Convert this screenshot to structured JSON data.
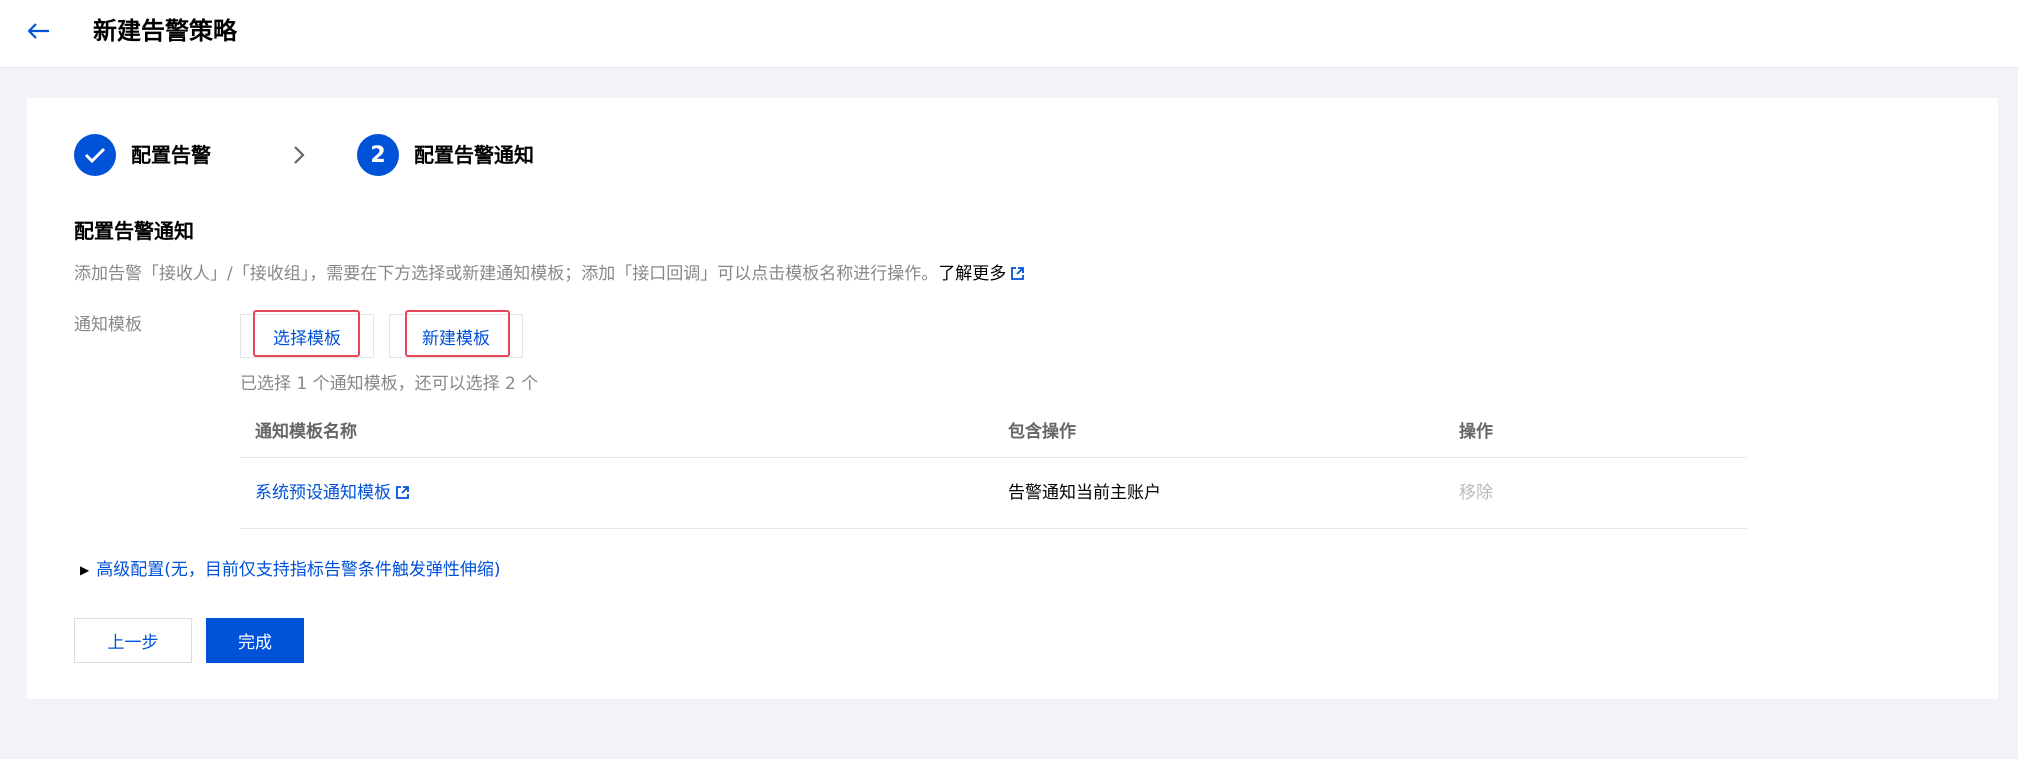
{
  "header": {
    "back_icon": "arrow-left-icon",
    "title": "新建告警策略"
  },
  "steps": [
    {
      "index": "",
      "label": "配置告警",
      "status": "done",
      "icon": "check-icon"
    },
    {
      "index": "2",
      "label": "配置告警通知",
      "status": "current"
    }
  ],
  "step_separator_icon": "chevron-right-icon",
  "section": {
    "title": "配置告警通知",
    "description": "添加告警「接收人」/「接收组」，需要在下方选择或新建通知模板；添加「接口回调」可以点击模板名称进行操作。",
    "learn_more": "了解更多",
    "learn_more_icon": "external-link-icon"
  },
  "template_field": {
    "label": "通知模板",
    "select_button": "选择模板",
    "create_button": "新建模板",
    "hint": "已选择 1 个通知模板，还可以选择 2 个"
  },
  "table": {
    "columns": [
      "通知模板名称",
      "包含操作",
      "操作"
    ],
    "rows": [
      {
        "name": "系统预设通知模板",
        "name_icon": "external-link-icon",
        "actions": "告警通知当前主账户",
        "operation": "移除"
      }
    ]
  },
  "advanced": {
    "icon": "triangle-right-icon",
    "label": "高级配置(无，目前仅支持指标告警条件触发弹性伸缩)"
  },
  "footer": {
    "prev_button": "上一步",
    "done_button": "完成"
  },
  "colors": {
    "primary": "#0052d9",
    "highlight_border": "#e5485b",
    "page_bg": "#f2f3f7"
  }
}
